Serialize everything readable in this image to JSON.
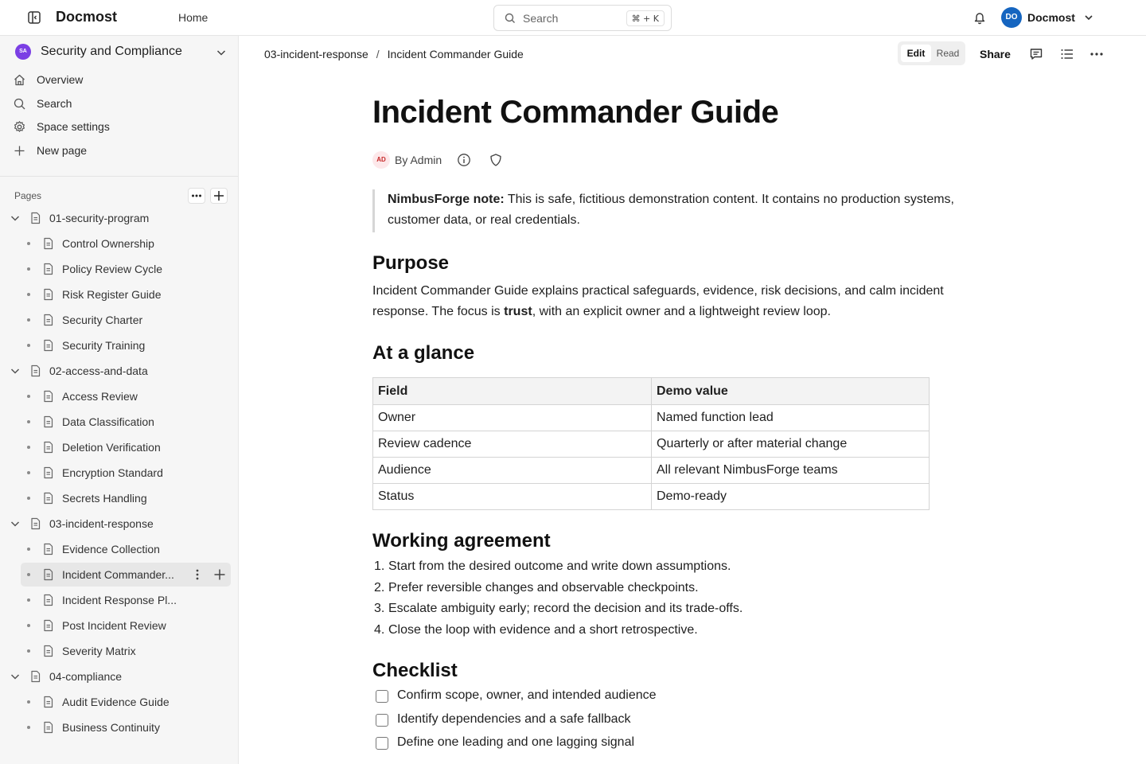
{
  "topbar": {
    "brand": "Docmost",
    "home": "Home",
    "search_label": "Search",
    "search_shortcut": "⌘ + K",
    "user_initials": "DO",
    "user_name": "Docmost"
  },
  "sidebar": {
    "space_initials": "SA",
    "space_name": "Security and Compliance",
    "nav": [
      {
        "label": "Overview",
        "icon": "home-icon"
      },
      {
        "label": "Search",
        "icon": "search-icon"
      },
      {
        "label": "Space settings",
        "icon": "gear-icon"
      },
      {
        "label": "New page",
        "icon": "plus-icon"
      }
    ],
    "pages_label": "Pages",
    "tree": [
      {
        "label": "01-security-program",
        "level": 0
      },
      {
        "label": "Control Ownership",
        "level": 1
      },
      {
        "label": "Policy Review Cycle",
        "level": 1
      },
      {
        "label": "Risk Register Guide",
        "level": 1
      },
      {
        "label": "Security Charter",
        "level": 1
      },
      {
        "label": "Security Training",
        "level": 1
      },
      {
        "label": "02-access-and-data",
        "level": 0
      },
      {
        "label": "Access Review",
        "level": 1
      },
      {
        "label": "Data Classification",
        "level": 1
      },
      {
        "label": "Deletion Verification",
        "level": 1
      },
      {
        "label": "Encryption Standard",
        "level": 1
      },
      {
        "label": "Secrets Handling",
        "level": 1
      },
      {
        "label": "03-incident-response",
        "level": 0
      },
      {
        "label": "Evidence Collection",
        "level": 1
      },
      {
        "label": "Incident Commander...",
        "level": 1,
        "active": true
      },
      {
        "label": "Incident Response Pl...",
        "level": 1
      },
      {
        "label": "Post Incident Review",
        "level": 1
      },
      {
        "label": "Severity Matrix",
        "level": 1
      },
      {
        "label": "04-compliance",
        "level": 0
      },
      {
        "label": "Audit Evidence Guide",
        "level": 1
      },
      {
        "label": "Business Continuity",
        "level": 1
      }
    ]
  },
  "header": {
    "breadcrumb_parent": "03-incident-response",
    "breadcrumb_sep": "/",
    "breadcrumb_current": "Incident Commander Guide",
    "mode_edit": "Edit",
    "mode_read": "Read",
    "share": "Share"
  },
  "doc": {
    "title": "Incident Commander Guide",
    "author_initials": "AD",
    "author": "By Admin",
    "callout_bold": "NimbusForge note:",
    "callout_text": " This is safe, fictitious demonstration content. It contains no production systems, customer data, or real credentials.",
    "purpose_heading": "Purpose",
    "purpose_text_1": "Incident Commander Guide explains practical safeguards, evidence, risk decisions, and calm incident response. The focus is ",
    "purpose_bold": "trust",
    "purpose_text_2": ", with an explicit owner and a lightweight review loop.",
    "glance_heading": "At a glance",
    "table_headers": [
      "Field",
      "Demo value"
    ],
    "table_rows": [
      [
        "Owner",
        "Named function lead"
      ],
      [
        "Review cadence",
        "Quarterly or after material change"
      ],
      [
        "Audience",
        "All relevant NimbusForge teams"
      ],
      [
        "Status",
        "Demo-ready"
      ]
    ],
    "agreement_heading": "Working agreement",
    "agreement_items": [
      {
        "num": "1.",
        "text": "Start from the desired outcome and write down assumptions."
      },
      {
        "num": "2.",
        "text": "Prefer reversible changes and observable checkpoints."
      },
      {
        "num": "3.",
        "text": "Escalate ambiguity early; record the decision and its trade-offs."
      },
      {
        "num": "4.",
        "text": "Close the loop with evidence and a short retrospective."
      }
    ],
    "checklist_heading": "Checklist",
    "checklist": [
      {
        "text": "Confirm scope, owner, and intended audience",
        "checked": false
      },
      {
        "text": "Identify dependencies and a safe fallback",
        "checked": false
      },
      {
        "text": "Define one leading and one lagging signal",
        "checked": false
      }
    ]
  }
}
